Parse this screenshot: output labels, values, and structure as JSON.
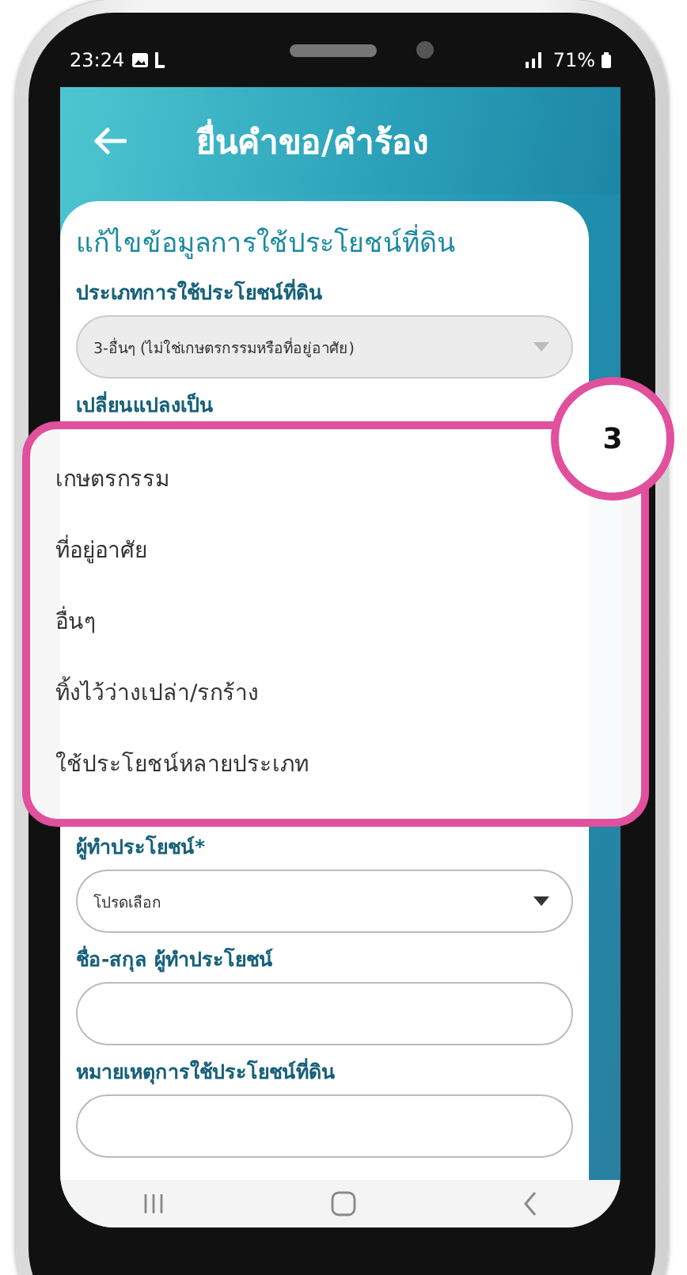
{
  "status_bar": {
    "time": "23:24",
    "battery": "71%"
  },
  "header": {
    "title": "ยื่นคำขอ/คำร้อง"
  },
  "form": {
    "title": "แก้ไขข้อมูลการใช้ประโยชน์ที่ดิน",
    "fields": [
      {
        "kind": "select",
        "label": "ประเภทการใช้ประโยชน์ที่ดิน",
        "value": "3-อื่นๆ (ไม่ใช่เกษตรกรรมหรือที่อยู่อาศัย)",
        "disabled": true
      },
      {
        "kind": "open-select",
        "label": "เปลี่ยนแปลงเป็น"
      },
      {
        "kind": "select",
        "label": "ผู้ทำประโยชน์*",
        "placeholder": "โปรดเลือก",
        "disabled": false
      },
      {
        "kind": "text",
        "label": "ชื่อ-สกุล ผู้ทำประโยชน์"
      },
      {
        "kind": "text",
        "label": "หมายเหตุการใช้ประโยชน์ที่ดิน"
      }
    ]
  },
  "dropdown": {
    "badge": "3",
    "options": [
      {
        "label": "เกษตรกรรม",
        "selected": false
      },
      {
        "label": "ที่อยู่อาศัย",
        "selected": false
      },
      {
        "label": "อื่นๆ",
        "selected": false
      },
      {
        "label": "ทิ้งไว้ว่างเปล่า/รกร้าง",
        "selected": false
      },
      {
        "label": "ใช้ประโยชน์หลายประเภท",
        "selected": false
      }
    ]
  }
}
